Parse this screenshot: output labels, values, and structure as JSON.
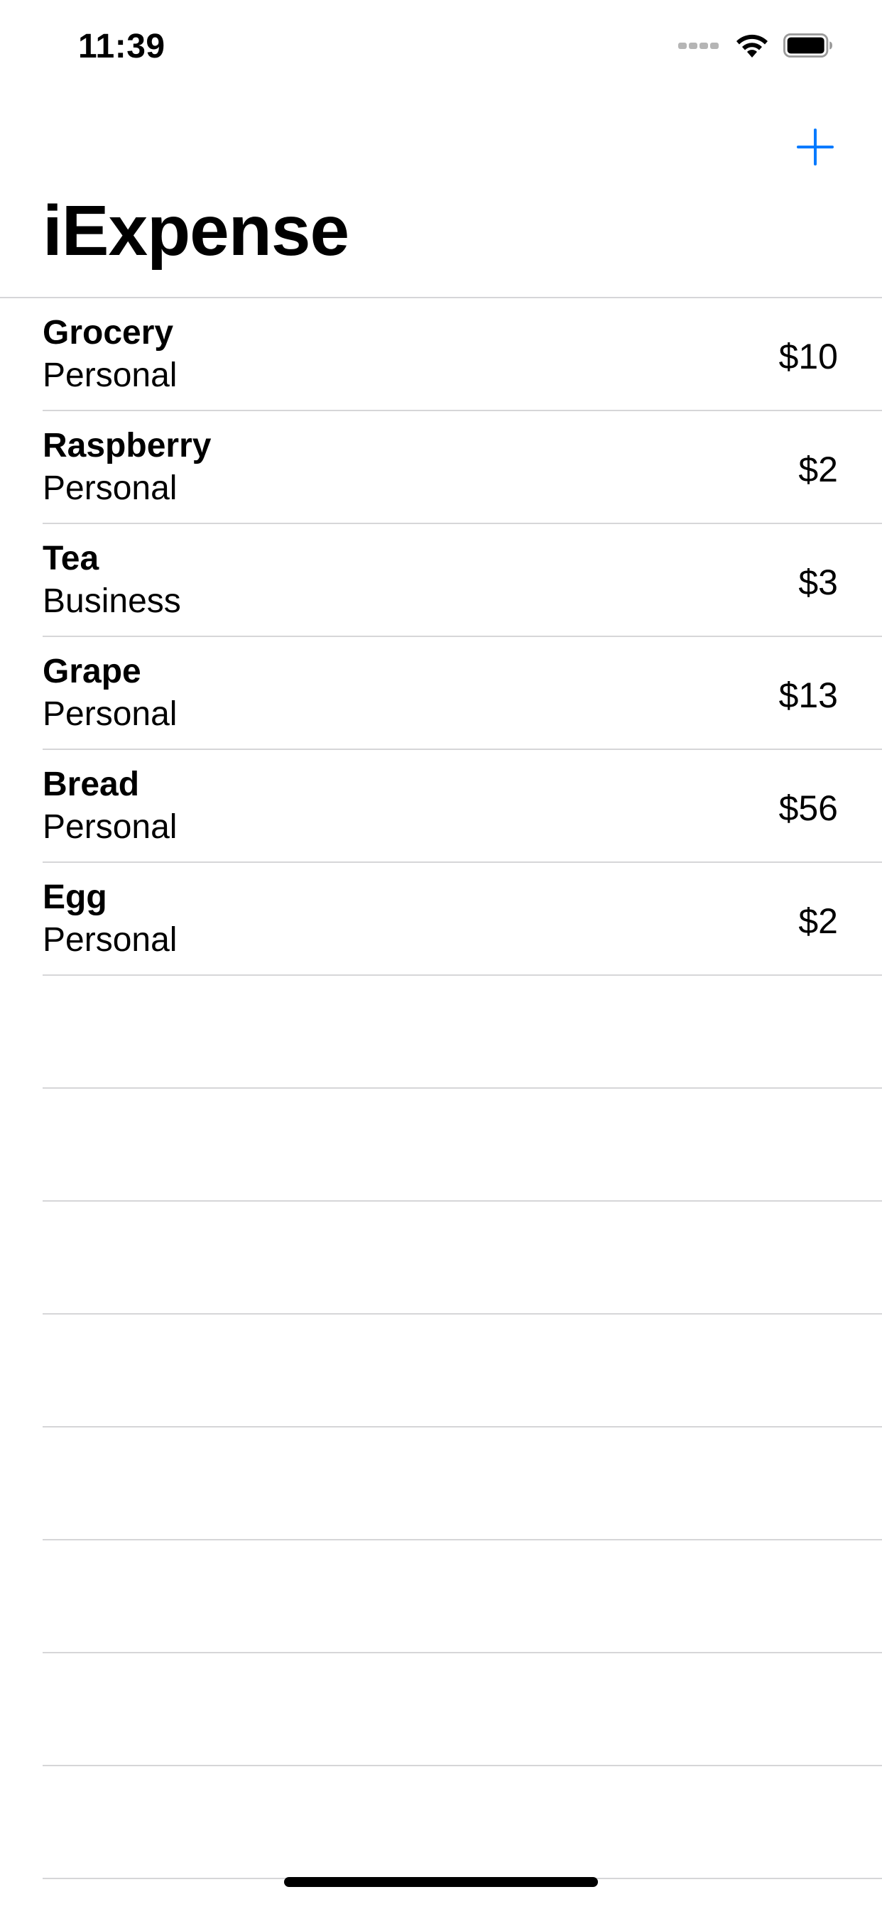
{
  "status_bar": {
    "time": "11:39",
    "icons": [
      "cellular-signal-icon",
      "wifi-icon",
      "battery-icon"
    ]
  },
  "nav": {
    "title": "iExpense",
    "add_icon": "plus-icon",
    "accent_color": "#007aff"
  },
  "expenses": [
    {
      "name": "Grocery",
      "type": "Personal",
      "amount": "$10"
    },
    {
      "name": "Raspberry",
      "type": "Personal",
      "amount": "$2"
    },
    {
      "name": "Tea",
      "type": "Business",
      "amount": "$3"
    },
    {
      "name": "Grape",
      "type": "Personal",
      "amount": "$13"
    },
    {
      "name": "Bread",
      "type": "Personal",
      "amount": "$56"
    },
    {
      "name": "Egg",
      "type": "Personal",
      "amount": "$2"
    }
  ],
  "colors": {
    "separator": "#d6d6d8",
    "background": "#ffffff",
    "text": "#000000"
  }
}
